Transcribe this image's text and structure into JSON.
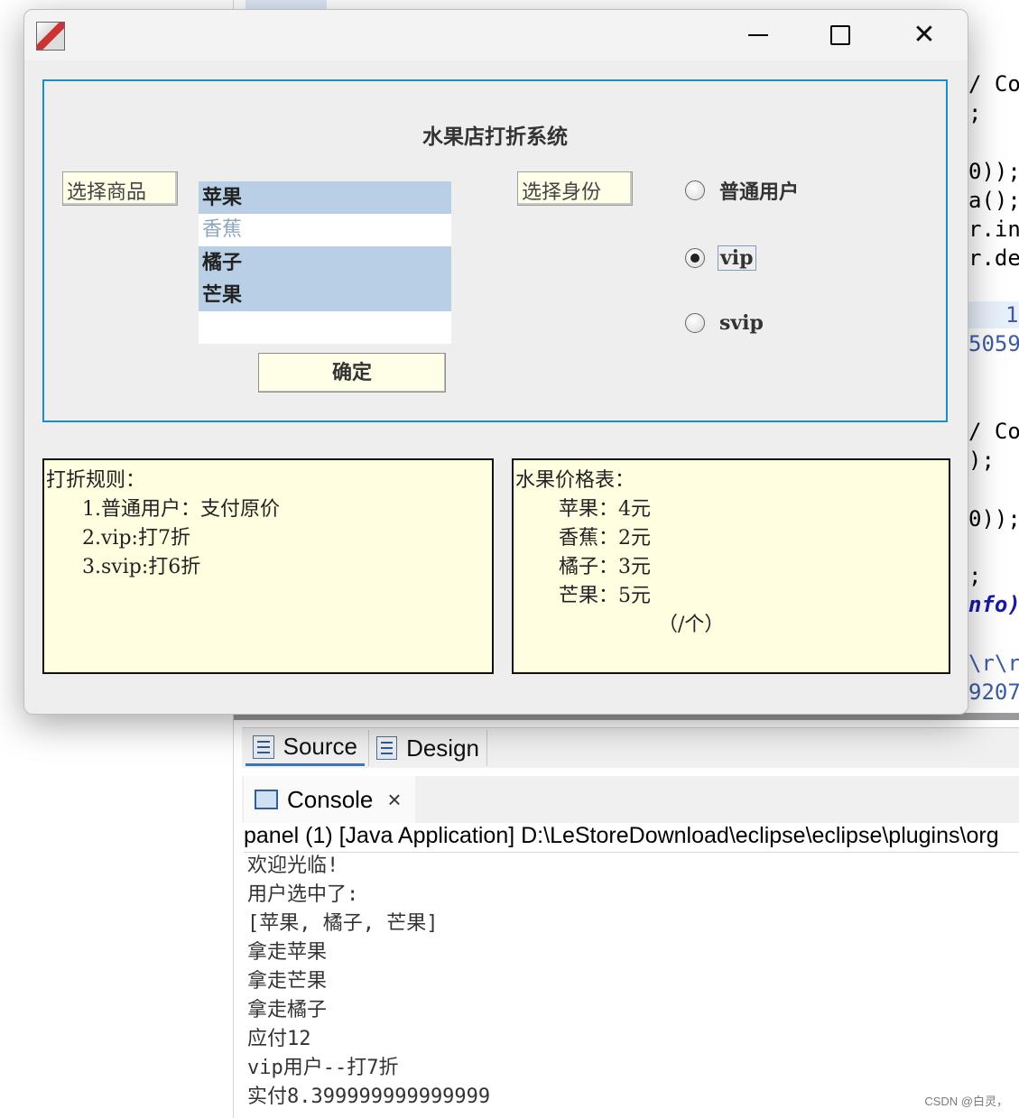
{
  "ide": {
    "gutter_partial": "239",
    "code_lines": [
      {
        "text": "/ Col"
      },
      {
        "text": ";"
      },
      {
        "text": "0));"
      },
      {
        "text": "a();"
      },
      {
        "text": "r.in"
      },
      {
        "text": "r.de"
      },
      {
        "text": "1"
      },
      {
        "text": "5059"
      },
      {
        "text": "/ Col"
      },
      {
        "text": ");"
      },
      {
        "text": "0));"
      },
      {
        "text": ";"
      },
      {
        "text": "nfo)"
      },
      {
        "text": "\\r\\r"
      },
      {
        "text": "9207"
      }
    ],
    "tabs": {
      "source": "Source",
      "design": "Design"
    },
    "console": {
      "tab_label": "Console",
      "header": "panel (1) [Java Application] D:\\LeStoreDownload\\eclipse\\eclipse\\plugins\\org",
      "lines": [
        "欢迎光临!",
        "用户选中了:",
        "[苹果, 橘子, 芒果]",
        "拿走苹果",
        "拿走芒果",
        "拿走橘子",
        "应付12",
        "vip用户--打7折",
        "实付8.399999999999999"
      ]
    },
    "watermark": "CSDN @白灵，"
  },
  "window": {
    "title_icon": "java-duke-icon",
    "panel_title": "水果店打折系统",
    "select_goods_label": "选择商品",
    "select_identity_label": "选择身份",
    "fruit_list": [
      {
        "label": "苹果",
        "selected": true
      },
      {
        "label": "香蕉",
        "selected": false
      },
      {
        "label": "橘子",
        "selected": true
      },
      {
        "label": "芒果",
        "selected": true
      }
    ],
    "confirm_label": "确定",
    "radios": [
      {
        "label": "普通用户",
        "checked": false
      },
      {
        "label": "vip",
        "checked": true
      },
      {
        "label": "svip",
        "checked": false
      }
    ],
    "rules": {
      "title": "打折规则：",
      "items": [
        "1.普通用户：支付原价",
        "2.vip:打7折",
        "3.svip:打6折"
      ]
    },
    "prices": {
      "title": "水果价格表：",
      "items": [
        "苹果：4元",
        "香蕉：2元",
        "橘子：3元",
        "芒果：5元"
      ],
      "unit": "（/个）"
    }
  },
  "colors": {
    "panel_border": "#1b8ec6",
    "selection": "#b8cfe6",
    "note_background": "#fffee0"
  }
}
